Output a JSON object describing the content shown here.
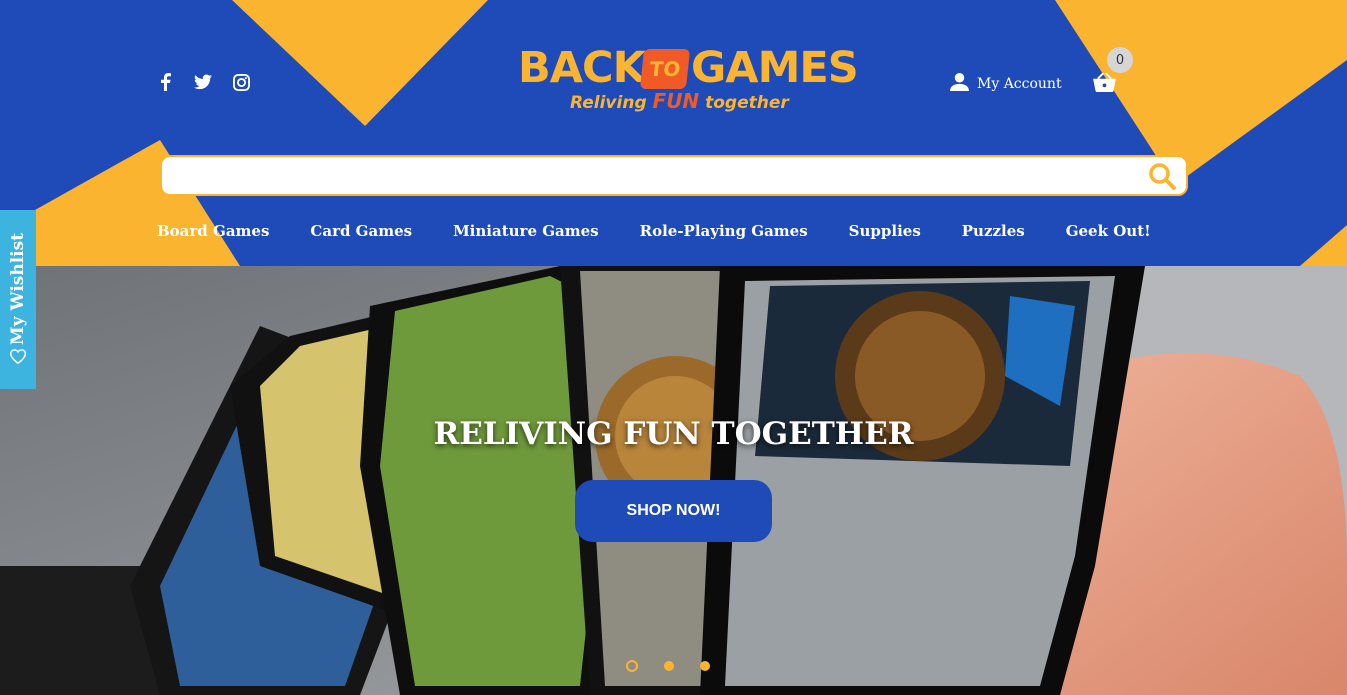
{
  "header": {
    "social": [
      "facebook-icon",
      "twitter-icon",
      "instagram-icon"
    ],
    "logo": {
      "word_left": "BACK",
      "die_text": "TO",
      "word_right": "GAMES",
      "tagline_pre": "Reliving ",
      "tagline_fun": "FUN",
      "tagline_post": " together"
    },
    "account_label": "My Account",
    "cart_label": "Your Cart",
    "cart_count": "0",
    "search": {
      "value": "",
      "placeholder": ""
    }
  },
  "nav": {
    "items": [
      {
        "label": "Board Games"
      },
      {
        "label": "Card Games"
      },
      {
        "label": "Miniature Games"
      },
      {
        "label": "Role-Playing Games"
      },
      {
        "label": "Supplies"
      },
      {
        "label": "Puzzles"
      },
      {
        "label": "Geek Out!"
      }
    ]
  },
  "hero": {
    "title": "RELIVING FUN TOGETHER",
    "button_label": "SHOP NOW!",
    "slide_count": 3,
    "active_slide": 1
  },
  "wishlist": {
    "label": "My Wishlist"
  },
  "colors": {
    "brand_blue": "#1f4bb8",
    "accent_yellow": "#fbb42f",
    "accent_orange": "#f05a26",
    "wishlist_cyan": "#3cb4df"
  }
}
